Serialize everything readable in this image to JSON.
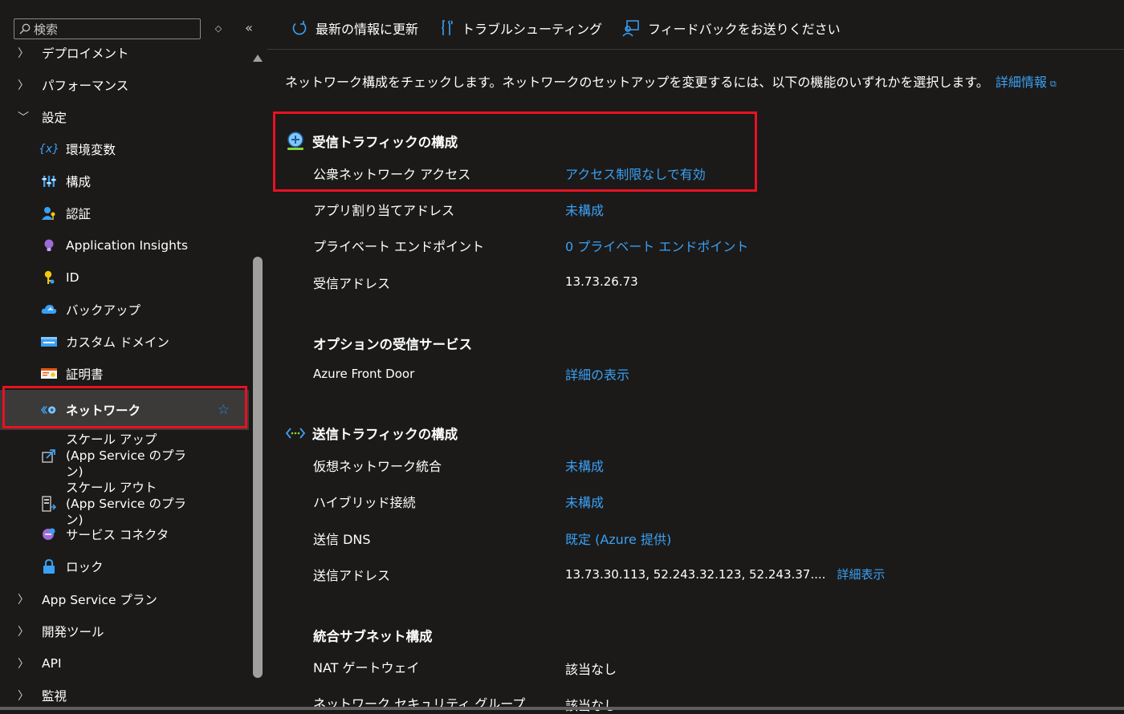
{
  "sidebar": {
    "search_placeholder": "検索",
    "items": [
      {
        "label": "デプロイメント",
        "kind": "group",
        "expanded": false
      },
      {
        "label": "パフォーマンス",
        "kind": "group",
        "expanded": false
      },
      {
        "label": "設定",
        "kind": "group",
        "expanded": true
      },
      {
        "label": "環境変数",
        "icon": "variable-icon"
      },
      {
        "label": "構成",
        "icon": "sliders-icon"
      },
      {
        "label": "認証",
        "icon": "user-key-icon"
      },
      {
        "label": "Application Insights",
        "icon": "lightbulb-icon"
      },
      {
        "label": "ID",
        "icon": "key-icon"
      },
      {
        "label": "バックアップ",
        "icon": "cloud-backup-icon"
      },
      {
        "label": "カスタム ドメイン",
        "icon": "domain-icon"
      },
      {
        "label": "証明書",
        "icon": "certificate-icon"
      },
      {
        "label": "ネットワーク",
        "icon": "network-icon",
        "selected": true
      },
      {
        "label": "スケール アップ (App Service のプラン)",
        "icon": "scale-up-icon"
      },
      {
        "label": "スケール アウト (App Service のプラン)",
        "icon": "scale-out-icon"
      },
      {
        "label": "サービス コネクタ",
        "icon": "service-connector-icon"
      },
      {
        "label": "ロック",
        "icon": "lock-icon"
      },
      {
        "label": "App Service プラン",
        "kind": "group",
        "expanded": false
      },
      {
        "label": "開発ツール",
        "kind": "group",
        "expanded": false
      },
      {
        "label": "API",
        "kind": "group",
        "expanded": false
      },
      {
        "label": "監視",
        "kind": "group",
        "expanded": false
      }
    ]
  },
  "toolbar": {
    "refresh_label": "最新の情報に更新",
    "troubleshoot_label": "トラブルシューティング",
    "feedback_label": "フィードバックをお送りください"
  },
  "main": {
    "intro_text": "ネットワーク構成をチェックします。ネットワークのセットアップを変更するには、以下の機能のいずれかを選択します。",
    "intro_link": "詳細情報",
    "inbound": {
      "title": "受信トラフィックの構成",
      "rows": [
        {
          "label": "公衆ネットワーク アクセス",
          "value": "アクセス制限なしで有効",
          "is_link": true
        },
        {
          "label": "アプリ割り当てアドレス",
          "value": "未構成",
          "is_link": true
        },
        {
          "label": "プライベート エンドポイント",
          "value": "0 プライベート エンドポイント",
          "is_link": true
        },
        {
          "label": "受信アドレス",
          "value": "13.73.26.73",
          "is_link": false
        }
      ]
    },
    "optional": {
      "title": "オプションの受信サービス",
      "rows": [
        {
          "label": "Azure Front Door",
          "value": "詳細の表示",
          "is_link": true
        }
      ]
    },
    "outbound": {
      "title": "送信トラフィックの構成",
      "rows": [
        {
          "label": "仮想ネットワーク統合",
          "value": "未構成",
          "is_link": true
        },
        {
          "label": "ハイブリッド接続",
          "value": "未構成",
          "is_link": true
        },
        {
          "label": "送信 DNS",
          "value": "既定 (Azure 提供)",
          "is_link": true
        },
        {
          "label": "送信アドレス",
          "value": "13.73.30.113, 52.243.32.123, 52.243.37....",
          "more": "詳細表示",
          "is_link": false
        }
      ]
    },
    "subnet": {
      "title": "統合サブネット構成",
      "rows": [
        {
          "label": "NAT ゲートウェイ",
          "value": "該当なし",
          "is_link": false
        },
        {
          "label": "ネットワーク セキュリティ グループ",
          "value": "該当なし",
          "is_link": false
        }
      ]
    }
  },
  "colors": {
    "link": "#3aa0f3",
    "highlight": "#e81123",
    "background": "#1b1a19",
    "selected": "#3b3a39"
  }
}
